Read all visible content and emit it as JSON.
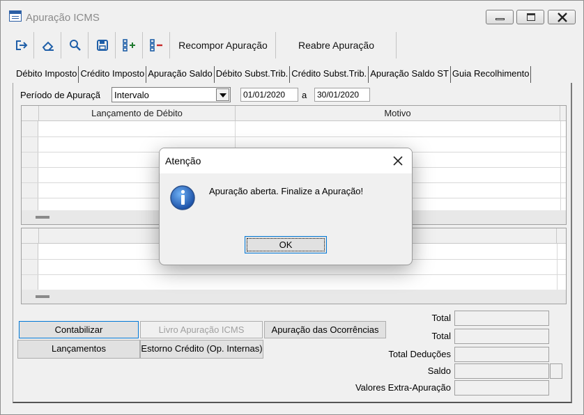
{
  "window": {
    "title": "Apuração ICMS"
  },
  "toolbar": {
    "icons": [
      "exit-icon",
      "eraser-icon",
      "search-icon",
      "save-icon",
      "add-list-icon",
      "remove-list-icon"
    ],
    "recompor_label": "Recompor Apuração",
    "reabre_label": "Reabre Apuração"
  },
  "tabs": [
    "Débito Imposto",
    "Crédito Imposto",
    "Apuração Saldo",
    "Débito Subst.Trib.",
    "Crédito Subst.Trib.",
    "Apuração Saldo ST",
    "Guia Recolhimento"
  ],
  "periodo": {
    "label": "Período de  Apuraçã",
    "mode": "Intervalo",
    "start": "01/01/2020",
    "separator": "a",
    "end": "30/01/2020"
  },
  "grid1": {
    "columns": [
      "Lançamento de Débito",
      "Motivo"
    ]
  },
  "buttons": {
    "contabilizar": "Contabilizar",
    "livro": "Livro Apuração ICMS",
    "ocorrencias": "Apuração das Ocorrências",
    "lancamentos": "Lançamentos",
    "estorno": "Estorno Crédito (Op. Internas)"
  },
  "totals": {
    "total1": "Total",
    "total2": "Total",
    "deducoes": "Total Deduções",
    "saldo": "Saldo",
    "extra": "Valores Extra-Apuração"
  },
  "dialog": {
    "title": "Atenção",
    "message": "Apuração aberta. Finalize a Apuração!",
    "ok": "OK"
  }
}
